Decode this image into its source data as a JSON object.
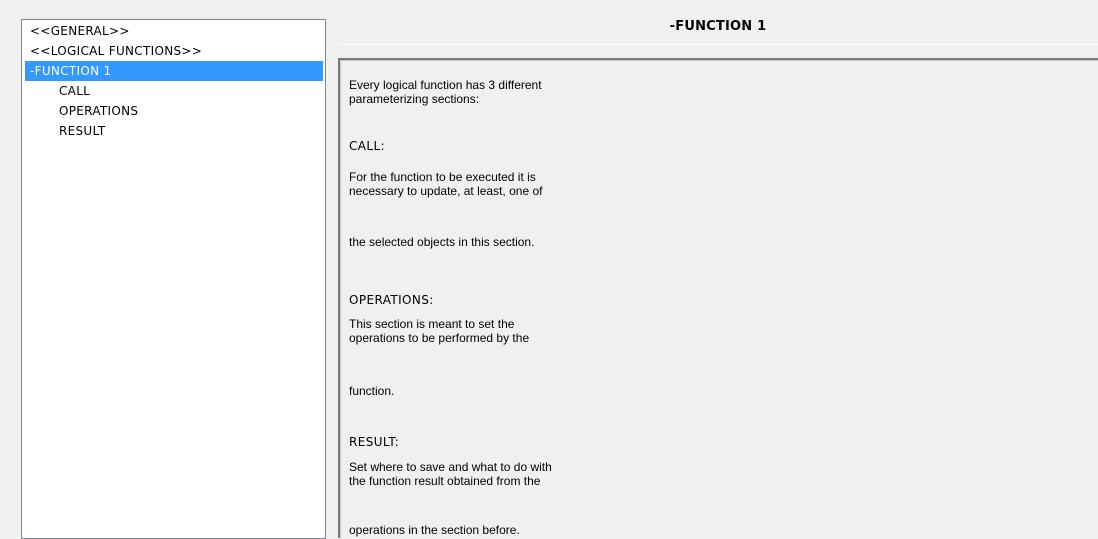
{
  "tree": {
    "items": [
      {
        "label": "<<GENERAL>>"
      },
      {
        "label": "<<LOGICAL FUNCTIONS>>"
      },
      {
        "label": "-FUNCTION 1"
      },
      {
        "label": "CALL"
      },
      {
        "label": "OPERATIONS"
      },
      {
        "label": "RESULT"
      }
    ],
    "selected_index": 2
  },
  "panel": {
    "title": "-FUNCTION 1",
    "intro_line1": "Every logical function has 3 different",
    "intro_line2": "parameterizing sections:",
    "call_header": "CALL:",
    "call_line1": "For the function to be executed it is",
    "call_line2": "necessary to update, at least, one of",
    "call_line3": "the selected objects in this section.",
    "operations_header": "OPERATIONS:",
    "operations_line1": "This section is meant to set the",
    "operations_line2": "operations to be performed by the",
    "operations_line3": "function.",
    "result_header": "RESULT:",
    "result_line1": "Set where to save and what to do with",
    "result_line2": "the function result obtained from the",
    "result_line3": "operations in the section before."
  },
  "colors": {
    "selection": "#3399ff",
    "background": "#f0f0f0"
  }
}
